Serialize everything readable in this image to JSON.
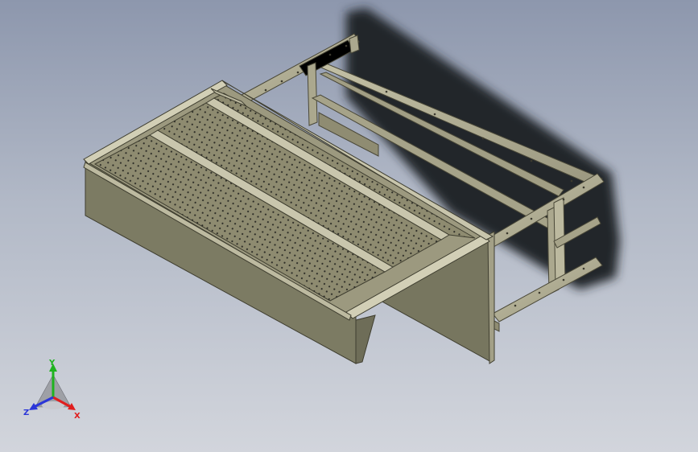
{
  "viewport": {
    "background_top": "#8d97ad",
    "background_bottom": "#d2d5dc"
  },
  "model": {
    "part_color": "#8e8b70",
    "panel_color": "#77765f",
    "frame_color": "#b7b49a",
    "shadow_color": "#24262b",
    "hole_color": "#2c2c26"
  },
  "triad": {
    "x_label": "X",
    "y_label": "Y",
    "z_label": "Z",
    "x_color": "#e01e1e",
    "y_color": "#1fb31f",
    "z_color": "#2b36d8"
  }
}
